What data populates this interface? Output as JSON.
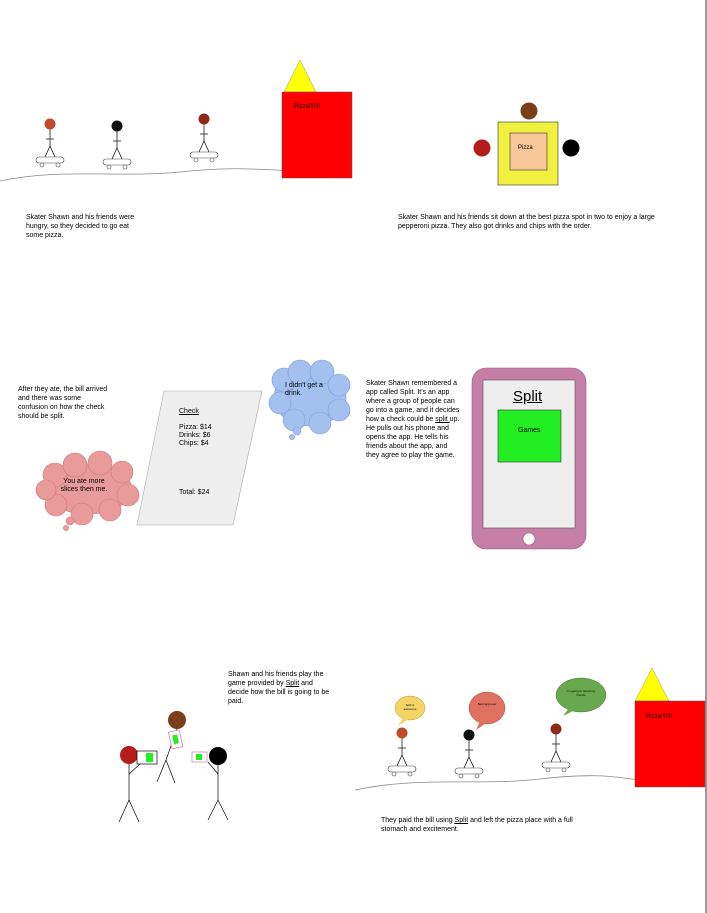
{
  "panels": {
    "p1": {
      "caption": "Skater Shawn and his friends were hungry, so they decided to go eat some pizza.",
      "sign": "Pizza!!!!!!!"
    },
    "p2": {
      "caption": "Skater Shawn and his friends sit down at the best pizza spot in two to enjoy a large pepperoni pizza. They also got drinks and chips with the order.",
      "box_label": "Pizza"
    },
    "p3": {
      "caption": "After they ate, the bill arrived and there was some confusion on how the check should be split.",
      "receipt_title": "Check",
      "receipt_lines": [
        "Pizza: $14",
        "Drinks: $6",
        "Chips: $4"
      ],
      "receipt_total": "Total: $24",
      "bubble_blue": "I didn't get a drink.",
      "bubble_red": "You ate more slices then me."
    },
    "p4": {
      "caption_parts": [
        "Skater Shawn remembered a app called Split. It's an app where a group of people can go into a game, and it decides how a check could be ",
        "split ",
        "up. He pulls out his phone and opens the app. He tells his friends about the app, and they agree to play the game."
      ],
      "app_title": "Split",
      "app_button": "Games"
    },
    "p5": {
      "caption_parts": [
        "Shawn and his friends play the game provided by ",
        "Split",
        " and decide how the bill is going to be paid."
      ]
    },
    "p6": {
      "caption_parts": [
        "They paid the bill using ",
        "Split",
        " and left the pizza place with a full stomach and excitement."
      ],
      "sign": "Pizza!!!!!!!",
      "bubble_yellow": "Split is awesome",
      "bubble_red": "Best app ever",
      "bubble_green": "I'm going to tell all my friends"
    }
  },
  "colors": {
    "pizza_building": "#ff0000",
    "roof": "#ffff00",
    "table": "#f0f040",
    "pizza_box": "#f8c898",
    "receipt": "#eeeeee",
    "bubble_blue": "#a3c0ef",
    "bubble_red": "#e99b9b",
    "phone_case": "#c57ea6",
    "phone_screen": "#eeeeee",
    "app_button": "#22ee22",
    "bubble_yellow": "#f5d466",
    "bubble_salmon": "#e07060",
    "bubble_green": "#6aa84f"
  }
}
